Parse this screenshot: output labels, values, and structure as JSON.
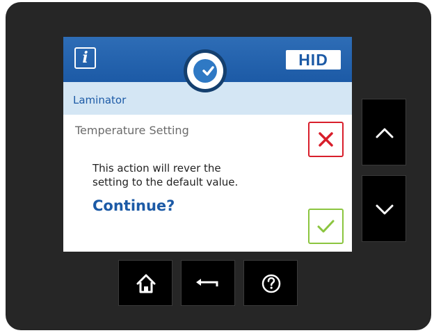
{
  "header": {
    "info_icon_glyph": "i",
    "brand_logo_text": "HID",
    "status_icon": "check-circle-icon"
  },
  "section": {
    "title": "Laminator"
  },
  "dialog": {
    "setting_name": "Temperature Setting",
    "message_line1": "This action will rever the",
    "message_line2": "setting to the default value.",
    "prompt": "Continue?",
    "cancel_icon": "x-icon",
    "confirm_icon": "checkmark-icon"
  },
  "hardware_buttons": {
    "side": [
      "chevron-up-icon",
      "chevron-down-icon"
    ],
    "bottom": [
      "home-icon",
      "back-arrow-icon",
      "help-icon"
    ]
  },
  "colors": {
    "bezel": "#262626",
    "header_blue": "#1c5aa6",
    "subheader_light_blue": "#d4e6f4",
    "cancel_red": "#d81e2b",
    "confirm_green": "#8bc53f",
    "hardware_button": "#000000"
  }
}
